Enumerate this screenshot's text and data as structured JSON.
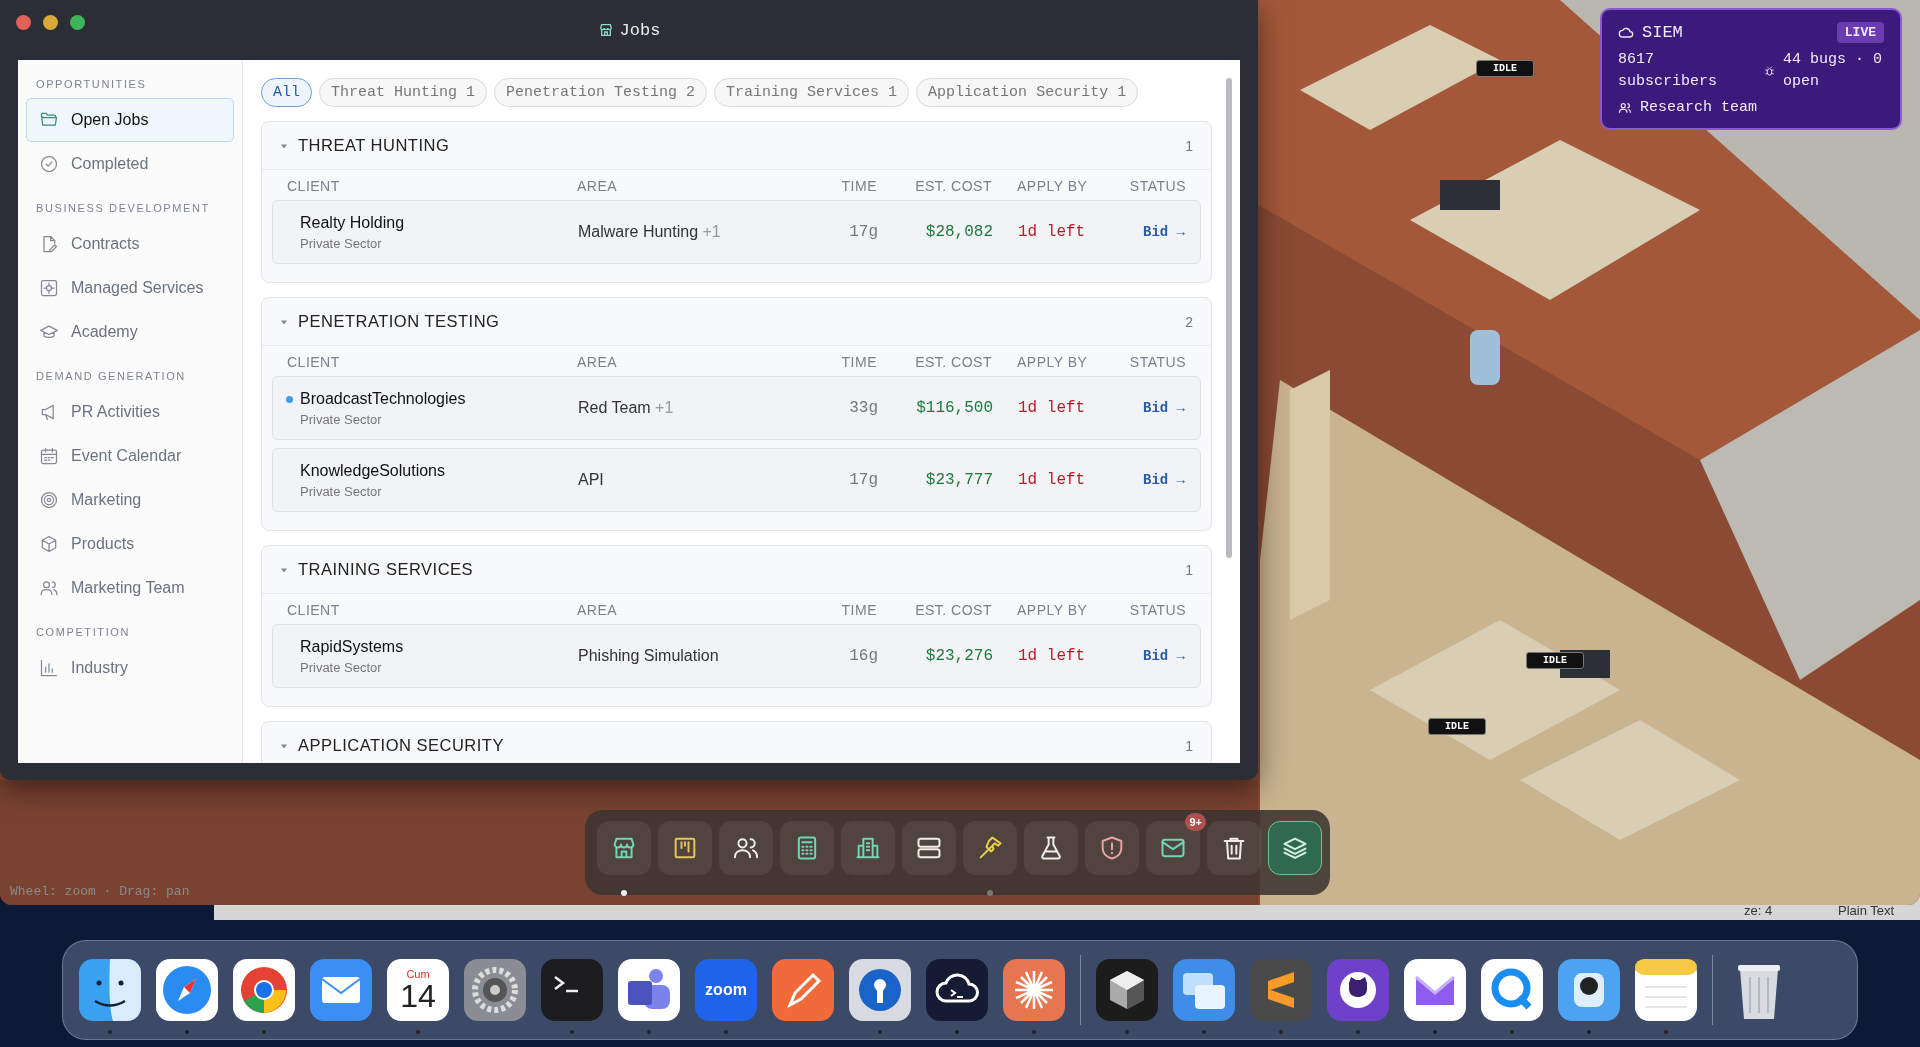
{
  "window": {
    "title": "Jobs"
  },
  "sidebar": {
    "sections": [
      {
        "heading": "OPPORTUNITIES",
        "items": [
          {
            "label": "Open Jobs",
            "selected": true
          },
          {
            "label": "Completed",
            "selected": false
          }
        ]
      },
      {
        "heading": "BUSINESS DEVELOPMENT",
        "items": [
          {
            "label": "Contracts",
            "selected": false
          },
          {
            "label": "Managed Services",
            "selected": false
          },
          {
            "label": "Academy",
            "selected": false
          }
        ]
      },
      {
        "heading": "DEMAND GENERATION",
        "items": [
          {
            "label": "PR Activities",
            "selected": false
          },
          {
            "label": "Event Calendar",
            "selected": false
          },
          {
            "label": "Marketing",
            "selected": false
          },
          {
            "label": "Products",
            "selected": false
          },
          {
            "label": "Marketing Team",
            "selected": false
          }
        ]
      },
      {
        "heading": "COMPETITION",
        "items": [
          {
            "label": "Industry",
            "selected": false
          }
        ]
      }
    ]
  },
  "filters": [
    {
      "label": "All",
      "selected": true
    },
    {
      "label": "Threat Hunting 1",
      "selected": false
    },
    {
      "label": "Penetration Testing 2",
      "selected": false
    },
    {
      "label": "Training Services 1",
      "selected": false
    },
    {
      "label": "Application Security 1",
      "selected": false
    }
  ],
  "groups": [
    {
      "title": "THREAT HUNTING",
      "count": "1",
      "expanded": true,
      "columns": [
        "CLIENT",
        "AREA",
        "TIME",
        "EST. COST",
        "APPLY BY",
        "STATUS"
      ],
      "rows": [
        {
          "client": "Realty Holding",
          "sector": "Private Sector",
          "area": "Malware Hunting",
          "area_extra": "+1",
          "time": "17g",
          "cost": "$28,082",
          "apply_by": "1d left",
          "status": "Bid →",
          "unread": false
        }
      ]
    },
    {
      "title": "PENETRATION TESTING",
      "count": "2",
      "expanded": true,
      "columns": [
        "CLIENT",
        "AREA",
        "TIME",
        "EST. COST",
        "APPLY BY",
        "STATUS"
      ],
      "rows": [
        {
          "client": "BroadcastTechnologies",
          "sector": "Private Sector",
          "area": "Red Team",
          "area_extra": "+1",
          "time": "33g",
          "cost": "$116,500",
          "apply_by": "1d left",
          "status": "Bid →",
          "unread": true
        },
        {
          "client": "KnowledgeSolutions",
          "sector": "Private Sector",
          "area": "API",
          "time": "17g",
          "cost": "$23,777",
          "apply_by": "1d left",
          "status": "Bid →",
          "unread": false
        }
      ]
    },
    {
      "title": "TRAINING SERVICES",
      "count": "1",
      "expanded": true,
      "columns": [
        "CLIENT",
        "AREA",
        "TIME",
        "EST. COST",
        "APPLY BY",
        "STATUS"
      ],
      "rows": [
        {
          "client": "RapidSystems",
          "sector": "Private Sector",
          "area": "Phishing Simulation",
          "time": "16g",
          "cost": "$23,276",
          "apply_by": "1d left",
          "status": "Bid →",
          "unread": false
        }
      ]
    },
    {
      "title": "APPLICATION SECURITY",
      "count": "1",
      "expanded": true
    }
  ],
  "game": {
    "tags": [
      "IDLE",
      "IDLE",
      "IDLE"
    ],
    "hint": "Wheel: zoom · Drag: pan"
  },
  "siem": {
    "title": "SIEM",
    "badge": "LIVE",
    "subscribers": "8617 subscribers",
    "bugs": "44 bugs · 0 open",
    "team": "Research team"
  },
  "toolbar": [
    {
      "kind": "store",
      "color": "#6fd6b8",
      "selected": true,
      "running": false,
      "highlighted": false
    },
    {
      "kind": "board",
      "color": "#e6c35c",
      "selected": false,
      "running": false,
      "highlighted": false
    },
    {
      "kind": "users",
      "color": "#eeeeee",
      "selected": false,
      "running": false,
      "highlighted": false
    },
    {
      "kind": "calculator",
      "color": "#6fd6b8",
      "selected": false,
      "running": false,
      "highlighted": false
    },
    {
      "kind": "building",
      "color": "#6fd6b8",
      "selected": false,
      "running": false,
      "highlighted": false
    },
    {
      "kind": "server",
      "color": "#eeeeee",
      "selected": false,
      "running": false,
      "highlighted": false
    },
    {
      "kind": "hammer",
      "color": "#e8d24a",
      "selected": false,
      "running": true,
      "highlighted": false
    },
    {
      "kind": "flask",
      "color": "#eeeeee",
      "selected": false,
      "running": false,
      "highlighted": false
    },
    {
      "kind": "shield",
      "color": "#e8a3a3",
      "selected": false,
      "running": false,
      "highlighted": false
    },
    {
      "kind": "mail",
      "color": "#6fd6b8",
      "badge": "9+",
      "selected": false,
      "running": false,
      "highlighted": false
    },
    {
      "kind": "trash",
      "color": "#eeeeee",
      "selected": false,
      "running": false,
      "highlighted": false
    },
    {
      "kind": "layers",
      "color": "#d8efe4",
      "selected": false,
      "running": false,
      "highlighted": true
    }
  ],
  "behind_window": {
    "status": "ze: 4",
    "language": "Plain Text"
  },
  "dock": [
    {
      "kind": "finder",
      "running": true
    },
    {
      "kind": "safari",
      "running": true
    },
    {
      "kind": "chrome",
      "running": true
    },
    {
      "kind": "mail",
      "running": false
    },
    {
      "kind": "calendar",
      "month": "Cum",
      "day": "14",
      "running": true
    },
    {
      "kind": "settings",
      "running": false
    },
    {
      "kind": "terminal",
      "running": true
    },
    {
      "kind": "teams",
      "running": true
    },
    {
      "kind": "zoom",
      "label": "zoom",
      "running": true
    },
    {
      "kind": "postman",
      "running": false
    },
    {
      "kind": "keyhole",
      "running": true
    },
    {
      "kind": "cloudterm",
      "running": true
    },
    {
      "kind": "asterisk",
      "running": true
    },
    {
      "kind": "divider"
    },
    {
      "kind": "cube",
      "running": true
    },
    {
      "kind": "windows",
      "running": true
    },
    {
      "kind": "sublime",
      "running": true
    },
    {
      "kind": "github",
      "running": true
    },
    {
      "kind": "protonmail",
      "running": true
    },
    {
      "kind": "qapp",
      "running": true
    },
    {
      "kind": "lens",
      "running": true
    },
    {
      "kind": "notes",
      "running": true
    },
    {
      "kind": "divider"
    },
    {
      "kind": "trash",
      "running": false
    }
  ]
}
